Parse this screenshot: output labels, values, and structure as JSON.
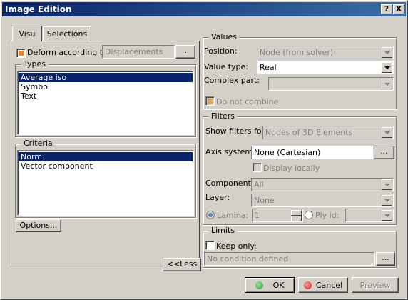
{
  "window": {
    "title": "Image Edition",
    "help_label": "?",
    "close_label": "X"
  },
  "tabs": [
    {
      "label": "Visu",
      "active": true
    },
    {
      "label": "Selections",
      "active": false
    }
  ],
  "deform": {
    "label": "Deform according to",
    "checked": true,
    "value": "Displacements",
    "browse_label": "..."
  },
  "types": {
    "title": "Types",
    "items": [
      "Average iso",
      "Symbol",
      "Text"
    ],
    "selected": "Average iso"
  },
  "criteria": {
    "title": "Criteria",
    "items": [
      "Norm",
      "Vector component"
    ],
    "selected": "Norm"
  },
  "options_label": "Options...",
  "less_label": "<<Less",
  "values": {
    "title": "Values",
    "position_label": "Position:",
    "position_value": "Node (from solver)",
    "value_type_label": "Value type:",
    "value_type_value": "Real",
    "complex_part_label": "Complex part:",
    "complex_part_value": "",
    "do_not_combine_label": "Do not combine"
  },
  "filters": {
    "title": "Filters",
    "show_filters_label": "Show filters for:",
    "show_filters_value": "Nodes of 3D Elements",
    "axis_system_label": "Axis system:",
    "axis_system_value": "None (Cartesian)",
    "axis_browse_label": "...",
    "display_locally_label": "Display locally",
    "component_label": "Component:",
    "component_value": "All",
    "layer_label": "Layer:",
    "layer_value": "None",
    "lamina_label": "Lamina:",
    "lamina_value": "1",
    "ply_id_label": "Ply id:",
    "ply_id_value": ""
  },
  "limits": {
    "title": "Limits",
    "keep_only_label": "Keep only:",
    "condition_placeholder": "No condition defined",
    "browse_label": "..."
  },
  "footer": {
    "ok_label": "OK",
    "cancel_label": "Cancel",
    "preview_label": "Preview"
  },
  "colors": {
    "title_bar": "#0a246a",
    "selection": "#0a246a",
    "ok_icon": "#2e9b3a",
    "cancel_icon": "#d02020",
    "checkbox_mark": "#e08a20"
  }
}
